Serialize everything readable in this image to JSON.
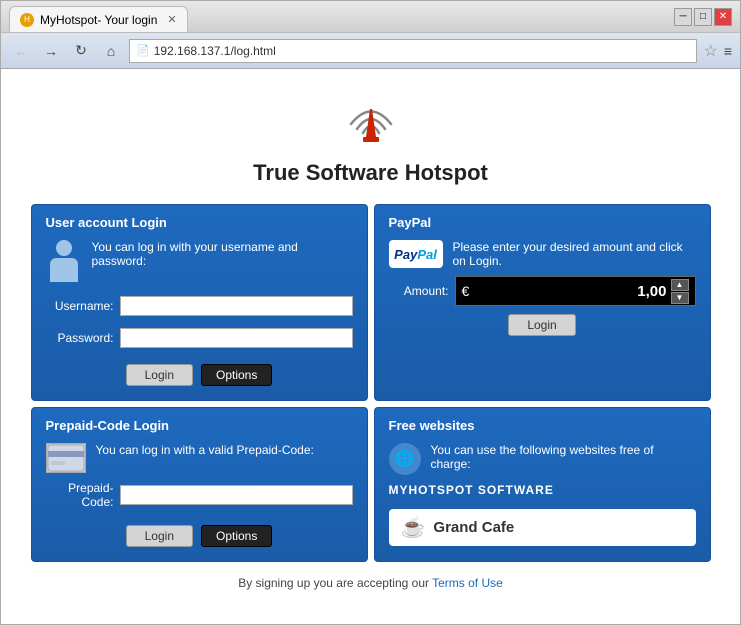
{
  "window": {
    "title": "MyHotspot- Your login",
    "url": "192.168.137.1/log.html"
  },
  "nav": {
    "back": "←",
    "forward": "→",
    "reload": "↻",
    "home": "⌂",
    "star": "☆",
    "menu": "≡"
  },
  "page": {
    "title": "True Software Hotspot"
  },
  "user_panel": {
    "header": "User account Login",
    "info_text": "You can log in with  your username and password:",
    "username_label": "Username:",
    "password_label": "Password:",
    "login_btn": "Login",
    "options_btn": "Options"
  },
  "paypal_panel": {
    "header": "PayPal",
    "info_text": "Please enter your desired amount and click on Login.",
    "amount_label": "Amount:",
    "currency": "€",
    "amount": "1,00",
    "login_btn": "Login"
  },
  "prepaid_panel": {
    "header": "Prepaid-Code Login",
    "info_text": "You can log in with a valid Prepaid-Code:",
    "code_label": "Prepaid-Code:",
    "login_btn": "Login",
    "options_btn": "Options"
  },
  "free_panel": {
    "header": "Free websites",
    "info_text": "You can use the  following websites  free of charge:",
    "software_label": "MYHOTSPOT SOFTWARE",
    "cafe_name": "Grand Cafe"
  },
  "footer": {
    "text": "By signing up you are accepting our ",
    "link_text": "Terms of Use"
  }
}
